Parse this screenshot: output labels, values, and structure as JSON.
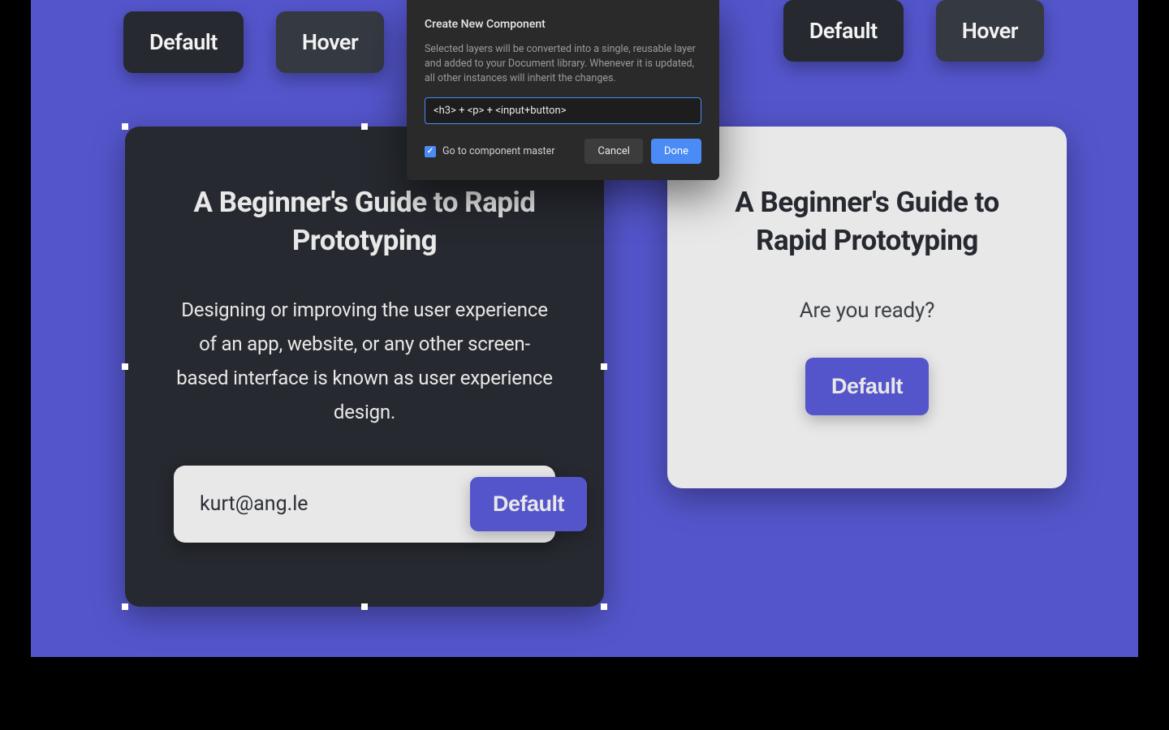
{
  "topButtonsLeft": [
    {
      "label": "Default"
    },
    {
      "label": "Hover"
    }
  ],
  "topButtonsRight": [
    {
      "label": "Default"
    },
    {
      "label": "Hover"
    }
  ],
  "cardDark": {
    "title": "A Beginner's Guide to Rapid Prototyping",
    "body": "Designing or improving the user experience of an app, website, or any other screen-based interface is known as user experience design.",
    "emailValue": "kurt@ang.le",
    "buttonLabel": "Default"
  },
  "cardLight": {
    "title": "A Beginner's Guide to Rapid Prototyping",
    "body": "Are you ready?",
    "buttonLabel": "Default"
  },
  "dialog": {
    "title": "Create New Component",
    "description": "Selected layers will be converted into a single, reusable layer and added to your Document library. Whenever it is updated, all other instances will inherit the changes.",
    "inputValue": "<h3> + <p> + <input+button>",
    "checkboxLabel": "Go to component master",
    "checkboxChecked": true,
    "cancelLabel": "Cancel",
    "doneLabel": "Done"
  },
  "colors": {
    "canvas": "#5455cb",
    "darkPanel": "#26292f",
    "lightPanel": "#e8e8e8",
    "dialogBg": "#2a2a2a",
    "accentBlue": "#4a8bf5"
  }
}
